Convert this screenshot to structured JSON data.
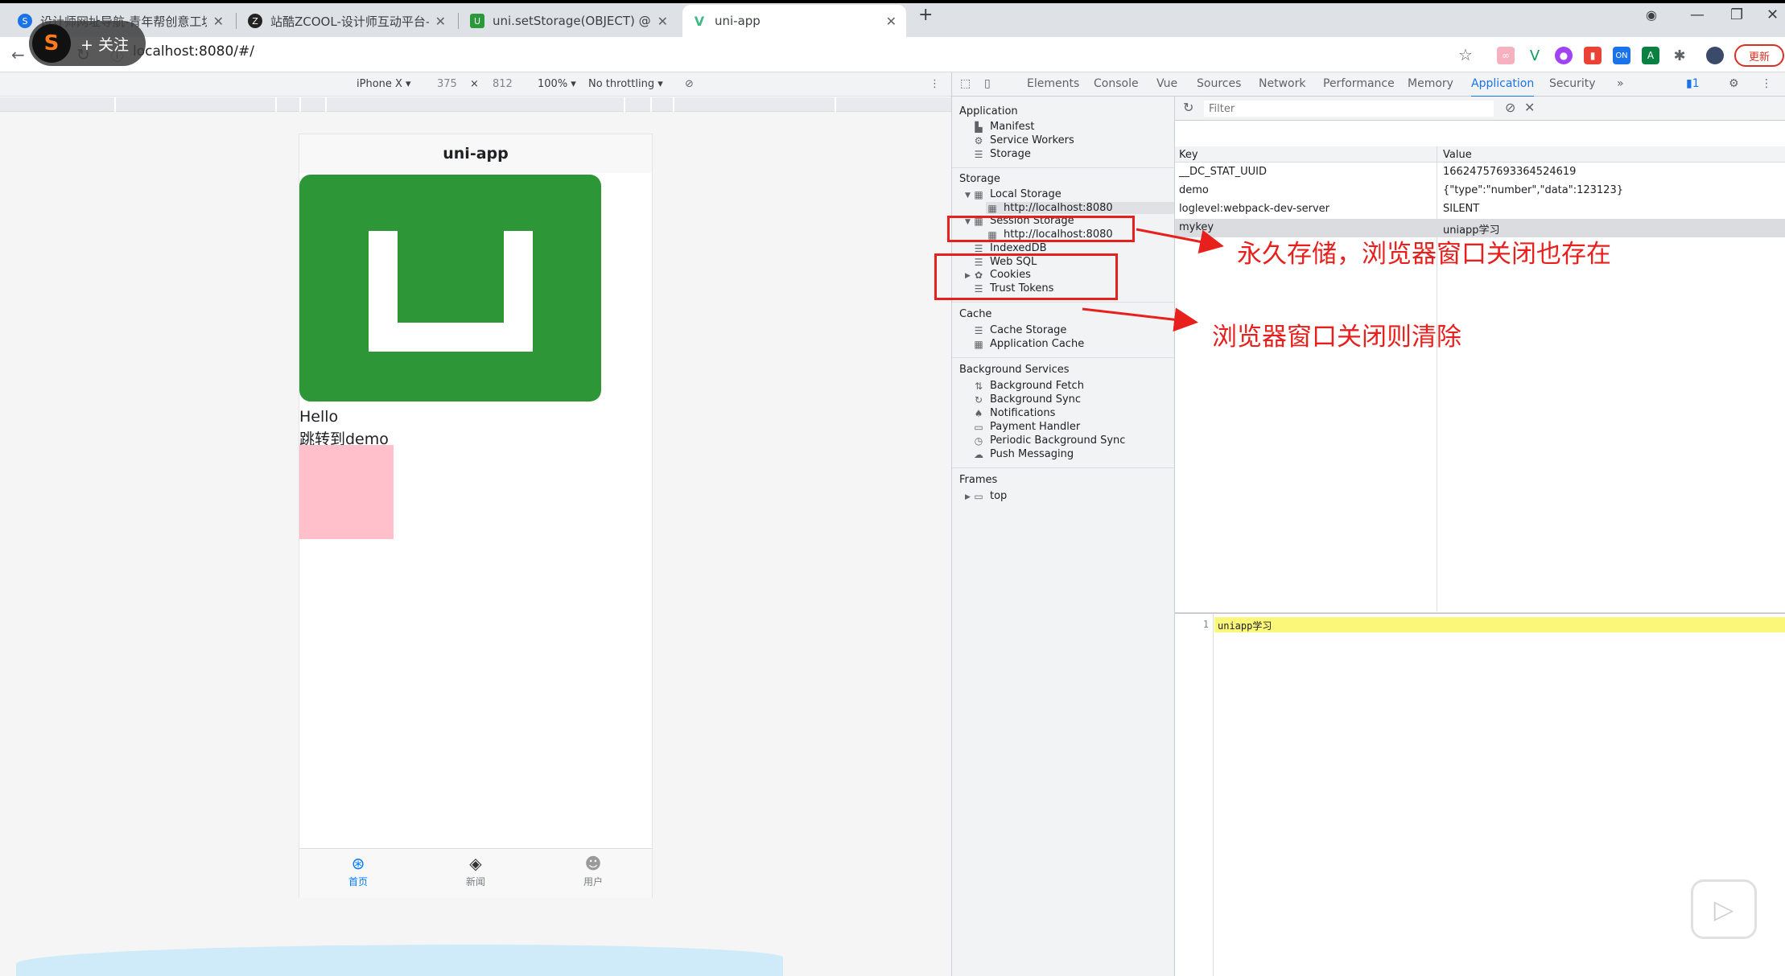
{
  "browser": {
    "tabs": [
      {
        "title": "设计师网址导航-青年帮创意工坊",
        "favicon_color": "#1a73e8"
      },
      {
        "title": "站酷ZCOOL-设计师互动平台-打",
        "favicon_color": "#222222"
      },
      {
        "title": "uni.setStorage(OBJECT) @sets",
        "favicon_color": "#2b9939"
      },
      {
        "title": "uni-app",
        "favicon_color": "#41b883"
      }
    ],
    "new_tab": "+",
    "url": "localhost:8080/#/",
    "update_label": "更新",
    "uploader_follow": "+ 关注"
  },
  "device_toolbar": {
    "device": "iPhone X ▾",
    "width": "375",
    "times": "×",
    "height": "812",
    "zoom": "100% ▾",
    "throttling": "No throttling ▾"
  },
  "phone": {
    "title": "uni-app",
    "hello": "Hello",
    "jump_link": "跳转到demo",
    "tabbar": [
      {
        "label": "首页",
        "icon": "home-icon"
      },
      {
        "label": "新闻",
        "icon": "layers-icon"
      },
      {
        "label": "用户",
        "icon": "users-icon"
      }
    ]
  },
  "devtools": {
    "tabs": [
      "Elements",
      "Console",
      "Vue",
      "Sources",
      "Network",
      "Performance",
      "Memory",
      "Application",
      "Security"
    ],
    "active_tab": "Application",
    "more": "»",
    "sidebar": {
      "application_title": "Application",
      "application_items": [
        "Manifest",
        "Service Workers",
        "Storage"
      ],
      "storage_title": "Storage",
      "local_storage": "Local Storage",
      "local_origin": "http://localhost:8080",
      "session_storage": "Session Storage",
      "session_origin": "http://localhost:8080",
      "storage_items": [
        "IndexedDB",
        "Web SQL",
        "Cookies",
        "Trust Tokens"
      ],
      "cache_title": "Cache",
      "cache_items": [
        "Cache Storage",
        "Application Cache"
      ],
      "bg_title": "Background Services",
      "bg_items": [
        "Background Fetch",
        "Background Sync",
        "Notifications",
        "Payment Handler",
        "Periodic Background Sync",
        "Push Messaging"
      ],
      "frames_title": "Frames",
      "frames_items": [
        "top"
      ]
    },
    "filter_placeholder": "Filter",
    "table": {
      "key_header": "Key",
      "value_header": "Value",
      "rows": [
        {
          "key": "__DC_STAT_UUID",
          "value": "16624757693364524619"
        },
        {
          "key": "demo",
          "value": "{\"type\":\"number\",\"data\":123123}"
        },
        {
          "key": "loglevel:webpack-dev-server",
          "value": "SILENT"
        },
        {
          "key": "mykey",
          "value": "uniapp学习"
        }
      ]
    },
    "preview": {
      "line_number": "1",
      "content": "uniapp学习"
    }
  },
  "annotations": {
    "local_note": "永久存储，浏览器窗口关闭也存在",
    "session_note": "浏览器窗口关闭则清除",
    "color": "#e8201d"
  }
}
